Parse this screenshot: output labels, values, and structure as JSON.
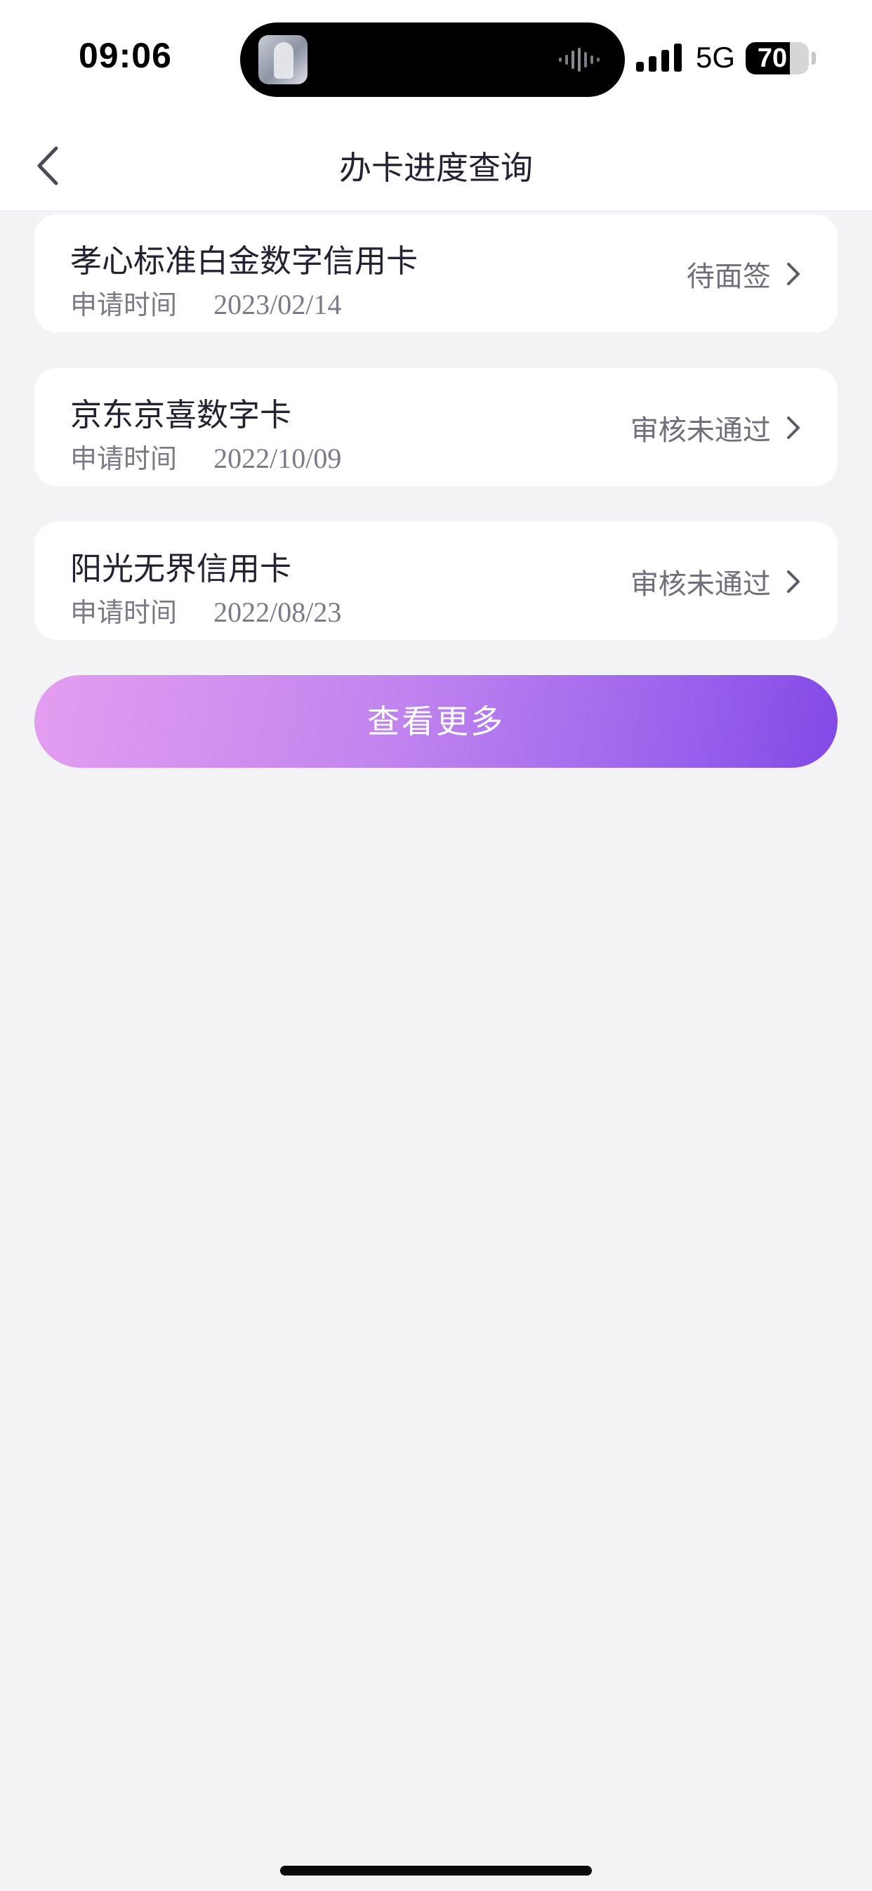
{
  "status_bar": {
    "time": "09:06",
    "network": "5G",
    "battery_percent": "70",
    "battery_level": 0.7,
    "signal_bars_filled": 4
  },
  "nav": {
    "title": "办卡进度查询",
    "back_icon": "chevron-left-icon"
  },
  "applications": [
    {
      "name": "孝心标准白金数字信用卡",
      "date_label": "申请时间",
      "date": "2023/02/14",
      "status": "待面签"
    },
    {
      "name": "京东京喜数字卡",
      "date_label": "申请时间",
      "date": "2022/10/09",
      "status": "审核未通过"
    },
    {
      "name": "阳光无界信用卡",
      "date_label": "申请时间",
      "date": "2022/08/23",
      "status": "审核未通过"
    }
  ],
  "more_button": {
    "label": "查看更多"
  },
  "colors": {
    "background": "#f3f3f6",
    "card": "#ffffff",
    "primary_text": "#222233",
    "secondary_text": "#7a7a88",
    "gradient_start": "#e39ef0",
    "gradient_end": "#8349e6"
  }
}
